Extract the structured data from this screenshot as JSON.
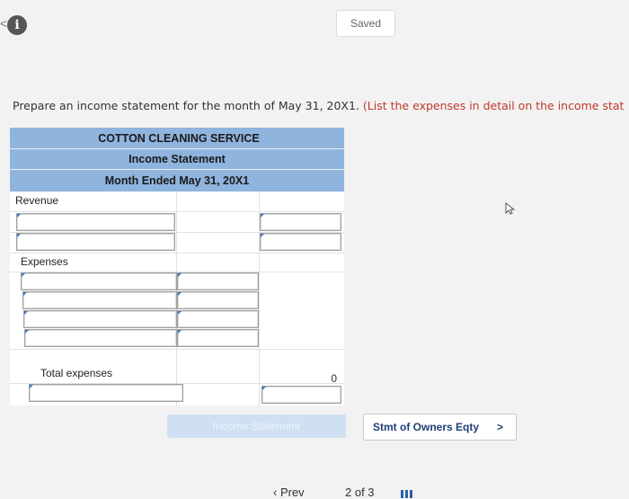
{
  "header": {
    "back_glyph": "<",
    "info_icon": "i",
    "saved_label": "Saved"
  },
  "instruction": {
    "main": "Prepare an income statement for the month of May 31, 20X1.",
    "note": "(List the expenses in detail on the income stat"
  },
  "statement": {
    "company": "COTTON CLEANING SERVICE",
    "title": "Income Statement",
    "period": "Month Ended May 31, 20X1",
    "revenue_label": "Revenue",
    "expenses_label": "Expenses",
    "total_expenses_label": "Total expenses",
    "total_expenses_value": "0",
    "colors": {
      "header_bg": "#8fb4de",
      "input_flag": "#3a77c4"
    }
  },
  "nav": {
    "prev_tab_label": "Income Statement",
    "next_tab_label": "Stmt of Owners Eqty",
    "next_chevron": ">",
    "footer_prev": "Prev",
    "footer_page": "2 of 3"
  }
}
